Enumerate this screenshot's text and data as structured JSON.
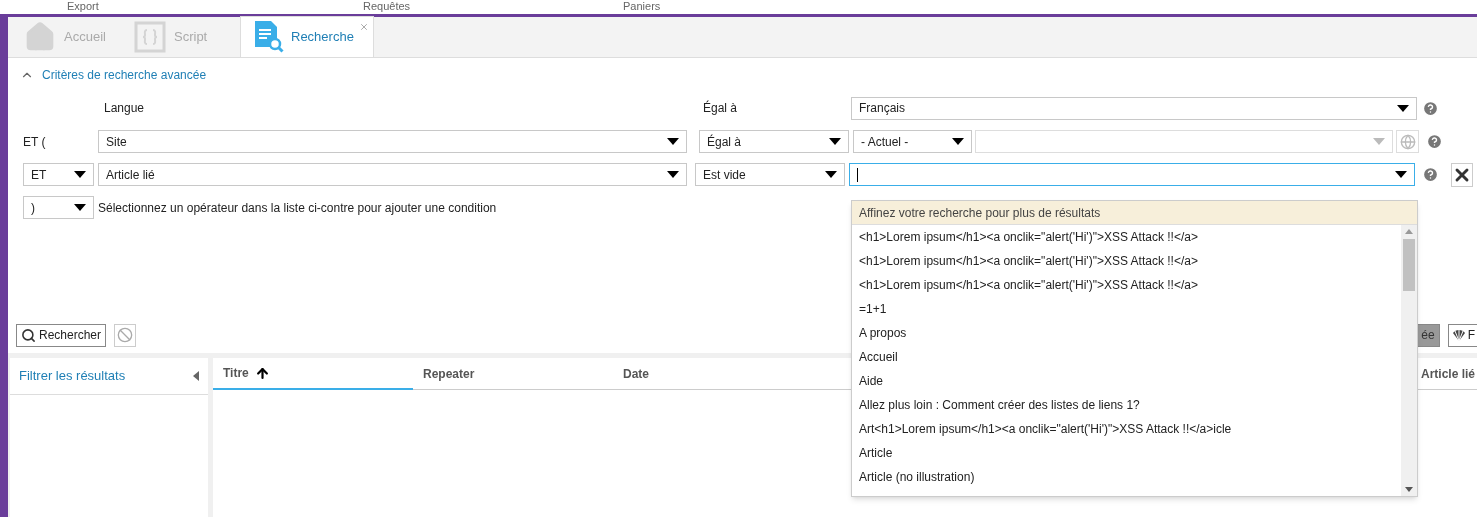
{
  "menu": [
    "Export",
    "Requêtes",
    "Paniers"
  ],
  "tabs": [
    {
      "label": "Accueil",
      "kind": "home",
      "selected": false
    },
    {
      "label": "Script",
      "kind": "script",
      "selected": false
    },
    {
      "label": "Recherche",
      "kind": "search",
      "selected": true
    }
  ],
  "criteria": {
    "title": "Critères de recherche avancée",
    "expanded": true
  },
  "header": {
    "field": "Langue",
    "operator": "Égal à",
    "value": "Français"
  },
  "rows": [
    {
      "prefix": {
        "kind": "label",
        "text": "ET ("
      },
      "field": "Site",
      "operator": "Égal à",
      "value": {
        "kind": "scope",
        "text": "- Actuel -"
      },
      "removable": false
    },
    {
      "prefix": {
        "kind": "select",
        "text": "ET"
      },
      "field": "Article lié",
      "operator": "Est vide",
      "value": {
        "kind": "combo"
      },
      "removable": true
    }
  ],
  "add_row": {
    "operator": ")",
    "hint": "Sélectionnez un opérateur dans la liste ci-contre pour ajouter une condition"
  },
  "suggest": {
    "notice": "Affinez votre recherche pour plus de résultats",
    "items": [
      "<h1>Lorem ipsum</h1><a onclik=\"alert('Hi')\">XSS Attack !!</a>",
      "<h1>Lorem ipsum</h1><a onclik=\"alert('Hi')\">XSS Attack !!</a>",
      "<h1>Lorem ipsum</h1><a onclik=\"alert('Hi')\">XSS Attack !!</a>",
      "=1+1",
      "A propos",
      "Accueil",
      "Aide",
      "Allez plus loin : Comment créer des listes de liens 1?",
      "Art<h1>Lorem ipsum</h1><a onclik=\"alert('Hi')\">XSS Attack !!</a>icle",
      "Article",
      "Article (no illustration)"
    ]
  },
  "actions": {
    "search": "Rechercher",
    "right_buttons": [
      {
        "label": "ée",
        "kind": "grey"
      },
      {
        "label": "F",
        "kind": "shell"
      }
    ]
  },
  "filter_panel": {
    "title": "Filtrer les résultats"
  },
  "table": {
    "columns": [
      {
        "label": "Titre",
        "sorted": true
      },
      {
        "label": "Repeater",
        "sorted": false
      },
      {
        "label": "Date",
        "sorted": false
      },
      {
        "label": "Article lié",
        "sorted": false
      }
    ]
  }
}
